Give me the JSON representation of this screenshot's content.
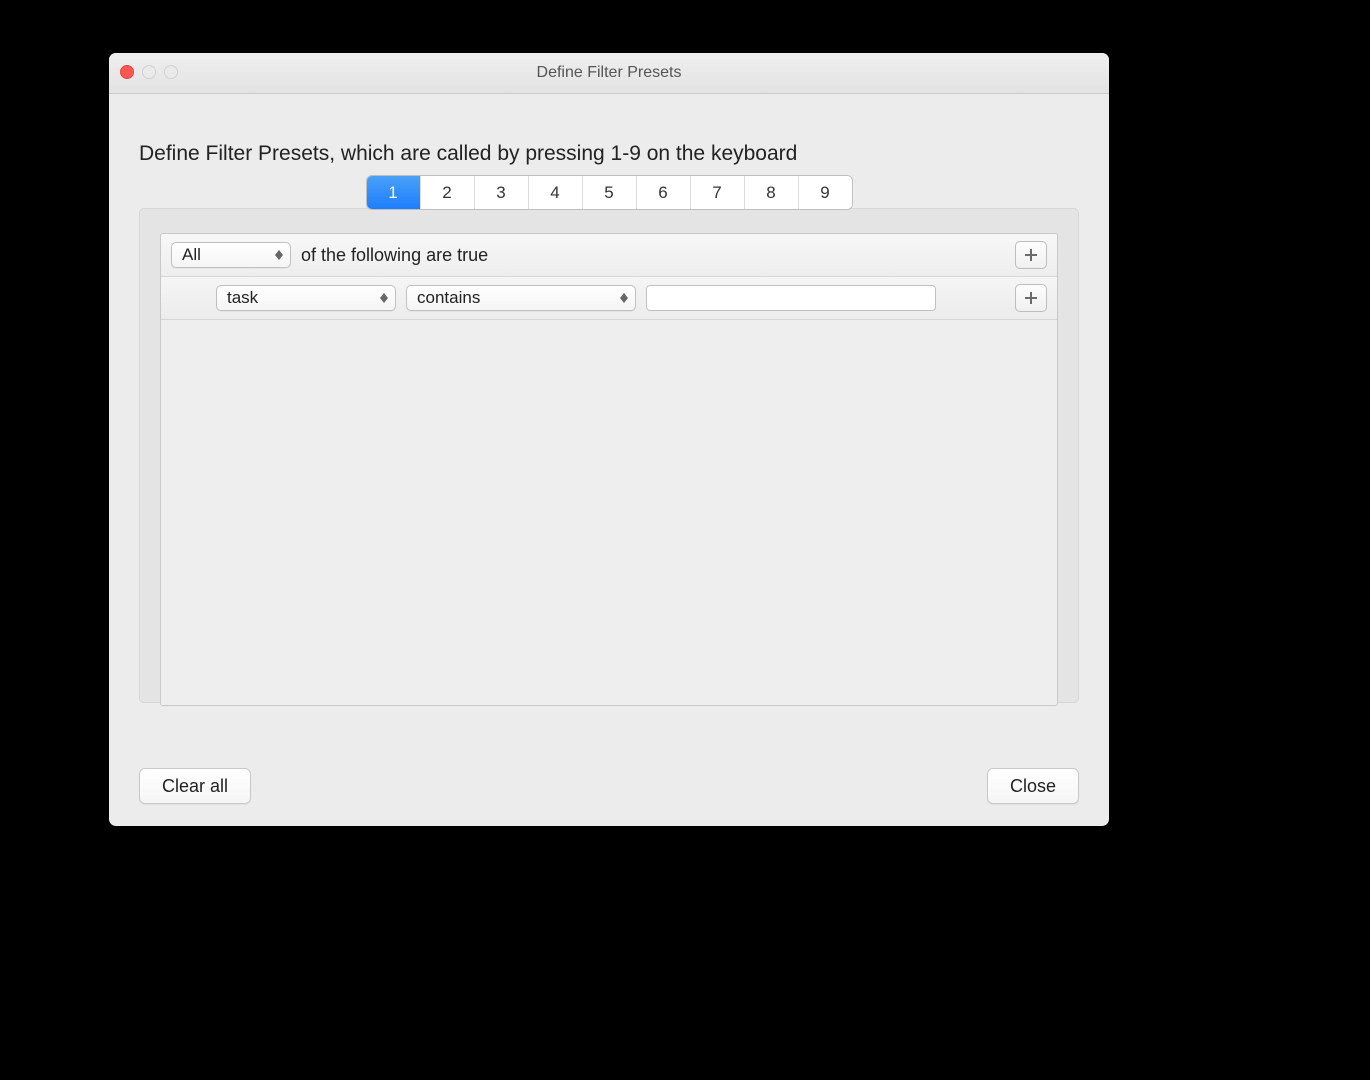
{
  "window": {
    "title": "Define Filter Presets"
  },
  "main": {
    "instruction": "Define Filter Presets, which are called by pressing 1-9 on the keyboard",
    "tabs": [
      "1",
      "2",
      "3",
      "4",
      "5",
      "6",
      "7",
      "8",
      "9"
    ],
    "selected_tab": "1",
    "rule_header": {
      "match_mode": "All",
      "suffix": "of the following are true"
    },
    "rule": {
      "field": "task",
      "operator": "contains",
      "value": ""
    }
  },
  "footer": {
    "clear": "Clear all",
    "close": "Close"
  }
}
